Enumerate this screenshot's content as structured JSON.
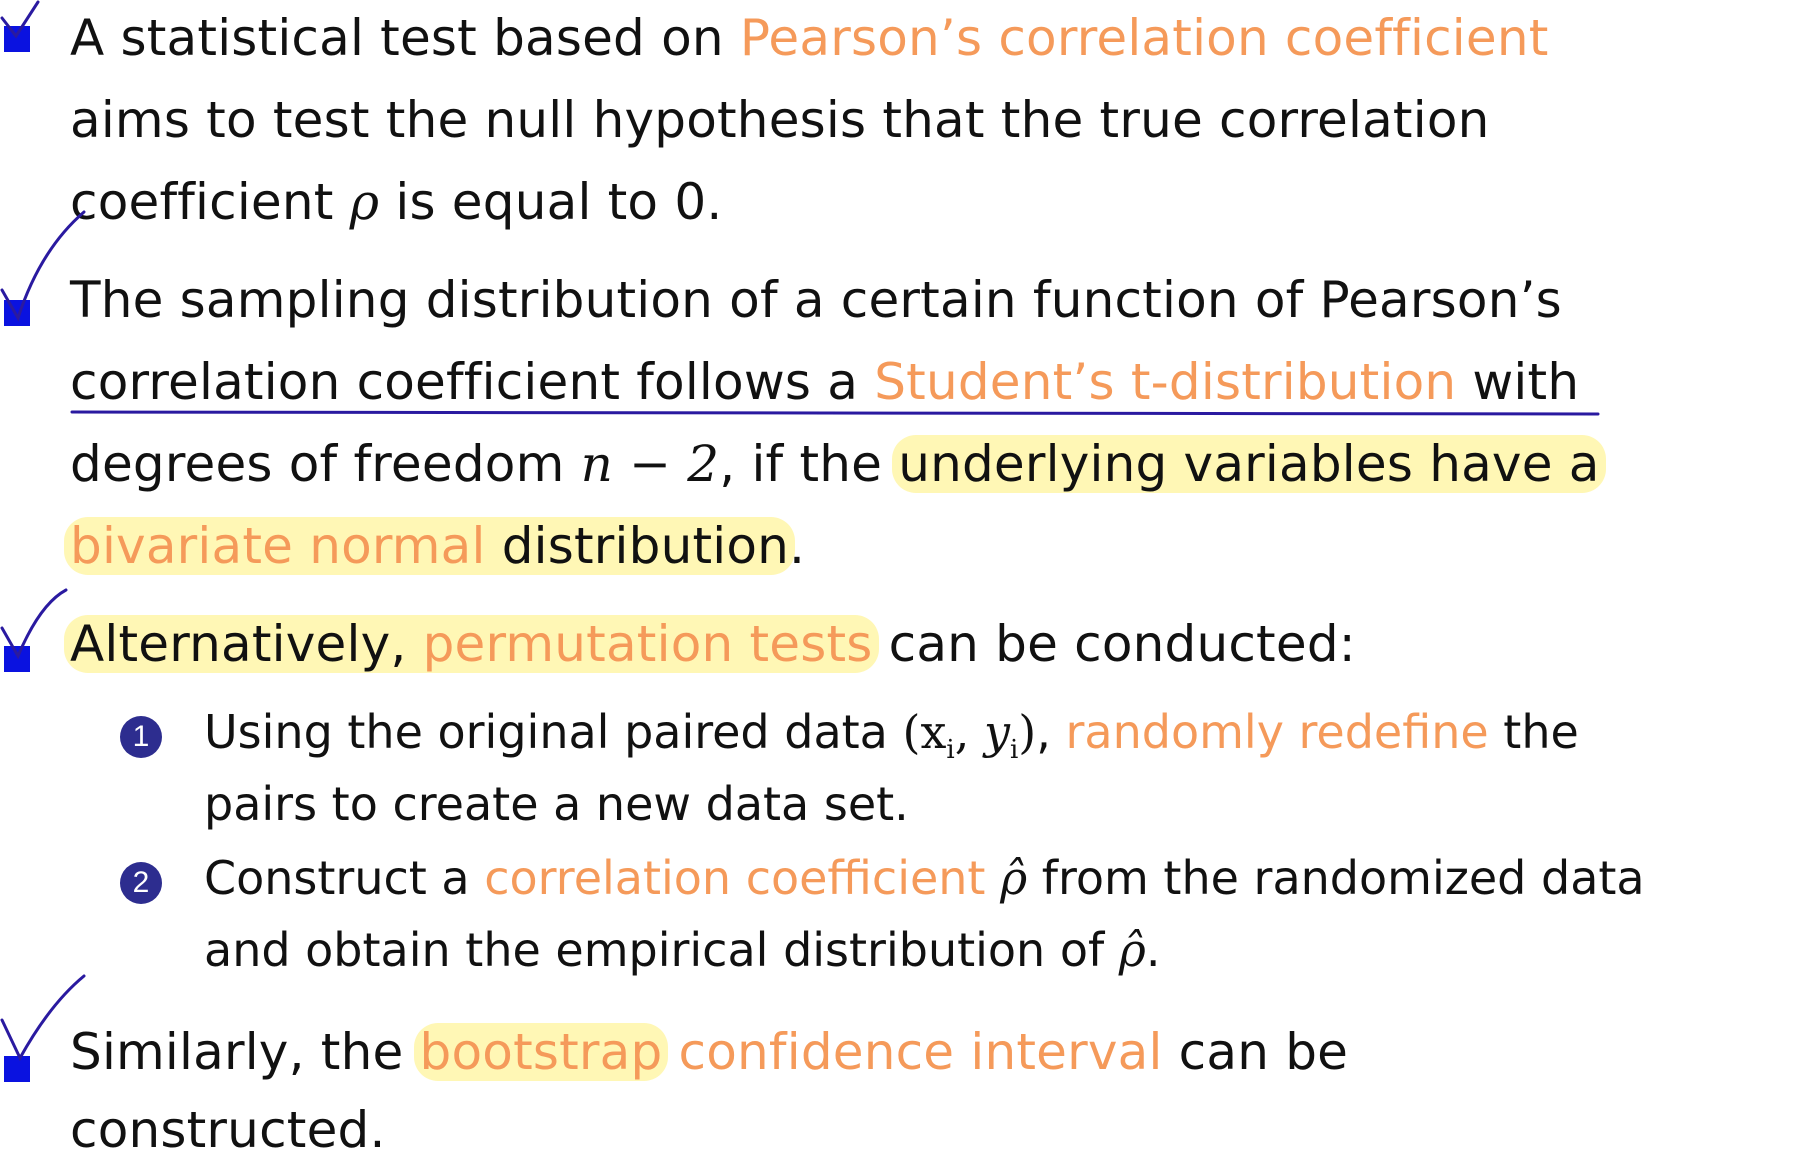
{
  "bullets": [
    {
      "lines": [
        {
          "a": "A statistical test based on ",
          "b": "Pearson’s correlation coefficient"
        },
        {
          "a": "aims to test the null hypothesis that the true correlation"
        },
        {
          "a": "coefficient ",
          "m": "ρ",
          "c": " is equal to 0."
        }
      ]
    },
    {
      "lines": [
        {
          "a": "The sampling distribution of a certain function of Pearson’s"
        },
        {
          "a": "correlation coefficient follows a ",
          "b": "Student’s t-distribution",
          "c": " with"
        },
        {
          "a": "degrees of freedom ",
          "m": "n − 2",
          "c": ", if the ",
          "h": "underlying variables have a"
        },
        {
          "h_orange": "bivariate normal",
          "h": " distribution",
          "c": "."
        }
      ]
    },
    {
      "lines": [
        {
          "h": "Alternatively, ",
          "h_orange": "permutation tests",
          "c": " can be conducted:"
        }
      ],
      "steps": [
        {
          "number": "1",
          "line1": {
            "a": "Using the original paired data ",
            "m": "(x",
            "c": ", ",
            "b": "randomly redefine",
            "d": " the"
          },
          "line2": "pairs to create a new data set."
        },
        {
          "number": "2",
          "line1": {
            "a": "Construct a ",
            "b": "correlation coefficient",
            "m": "ρ̂",
            "c": " from the randomized data"
          },
          "line2": {
            "a": "and obtain the empirical distribution of ",
            "m": "ρ̂",
            "c": "."
          }
        }
      ]
    },
    {
      "lines": [
        {
          "a": "Similarly, the ",
          "h_orange": "bootstrap",
          "b": " confidence interval",
          "c": " can be"
        },
        {
          "a": "constructed."
        }
      ]
    }
  ],
  "colors": {
    "accent": "#f59a5a",
    "bullet": "#0a12e0",
    "enum": "#2d2d8f",
    "highlight": "#fff078",
    "ink": "#2a1aa0"
  },
  "icons": [
    "checkmark-annotation-icon",
    "square-bullet-icon",
    "numbered-circle-icon"
  ]
}
